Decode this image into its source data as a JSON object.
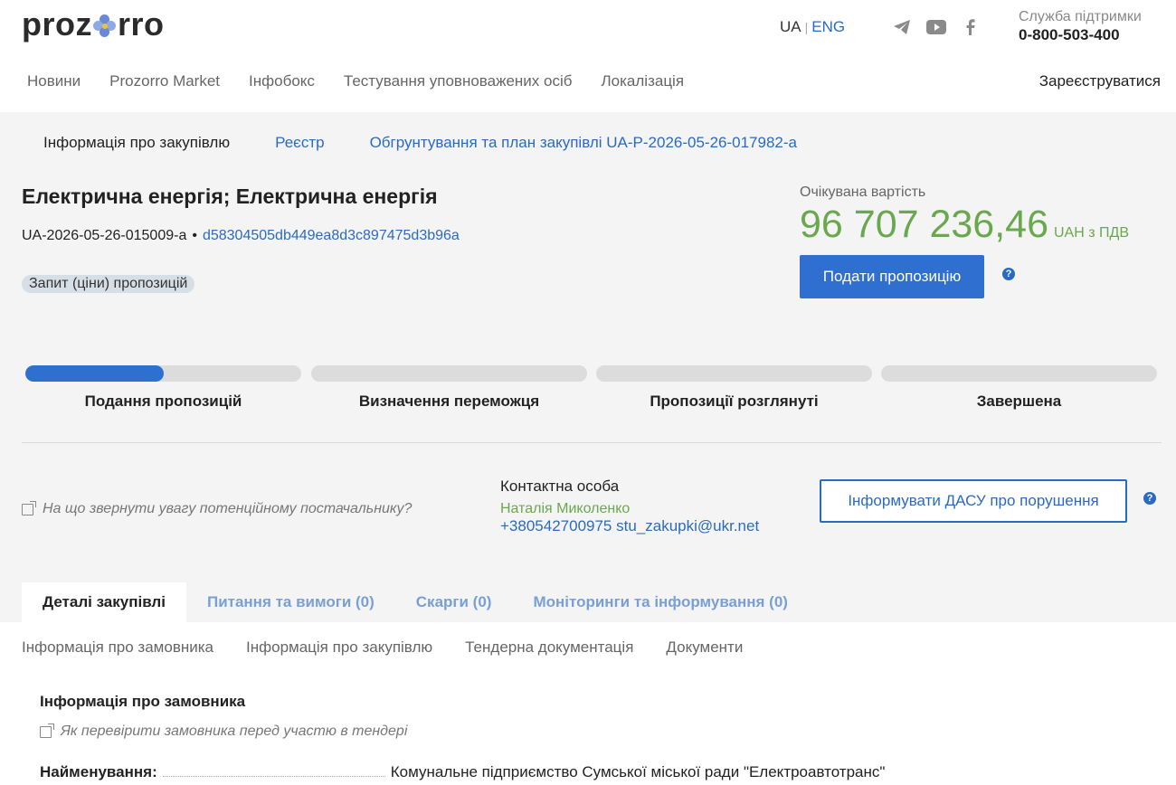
{
  "header": {
    "logo_text_left": "proz",
    "logo_text_right": "rro",
    "lang_ua": "UA",
    "lang_sep": "|",
    "lang_eng": "ENG",
    "social_icons": [
      "telegram-icon",
      "youtube-icon",
      "facebook-icon"
    ],
    "support_label": "Служба підтримки",
    "support_phone": "0-800-503-400",
    "nav": [
      "Новини",
      "Prozorro Market",
      "Інфобокс",
      "Тестування уповноважених осіб",
      "Локалізація"
    ],
    "register": "Зареєструватися"
  },
  "breadcrumbs": {
    "current": "Інформація про закупівлю",
    "registry": "Реєстр",
    "plan": "Обгрунтування та план закупівлі UA-P-2026-05-26-017982-a"
  },
  "tender": {
    "title": "Електрична енергія; Електрична енергія",
    "id": "UA-2026-05-26-015009-a",
    "dot": "•",
    "hash": "d58304505db449ea8d3c897475d3b96a",
    "badge": "Запит (ціни) пропозицій",
    "expected_label": "Очікувана вартість",
    "expected_value": "96 707 236,46",
    "expected_currency": "UAH з ПДВ",
    "offer_button": "Подати пропозицію"
  },
  "stages": [
    {
      "label": "Подання пропозицій",
      "progress": 0.5
    },
    {
      "label": "Визначення переможця",
      "progress": 0
    },
    {
      "label": "Пропозиції розглянуті",
      "progress": 0
    },
    {
      "label": "Завершена",
      "progress": 0
    }
  ],
  "attention_text": "На що звернути увагу потенційному постачальнику?",
  "contact": {
    "heading": "Контактна особа",
    "name": "Наталія Миколенко",
    "phone_email": "+380542700975 stu_zakupki@ukr.net"
  },
  "dasu_button": "Інформувати ДАСУ про порушення",
  "help_glyph": "?",
  "tabs": [
    "Деталі закупівлі",
    "Питання та вимоги (0)",
    "Скарги (0)",
    "Моніторинги та інформування (0)"
  ],
  "subnav": [
    "Інформація про замовника",
    "Інформація про закупівлю",
    "Тендерна документація",
    "Документи"
  ],
  "customer": {
    "section_title": "Інформація про замовника",
    "howto": "Як перевірити замовника перед участю в тендері",
    "name_key": "Найменування:",
    "name_value": "Комунальне підприємство Сумської міської ради \"Електроавтотранс\""
  },
  "colors": {
    "accent_blue": "#2f6fd0",
    "link_blue": "#2b6bbf",
    "price_green": "#6aa84f",
    "panel_grey": "#f4f4f4"
  }
}
